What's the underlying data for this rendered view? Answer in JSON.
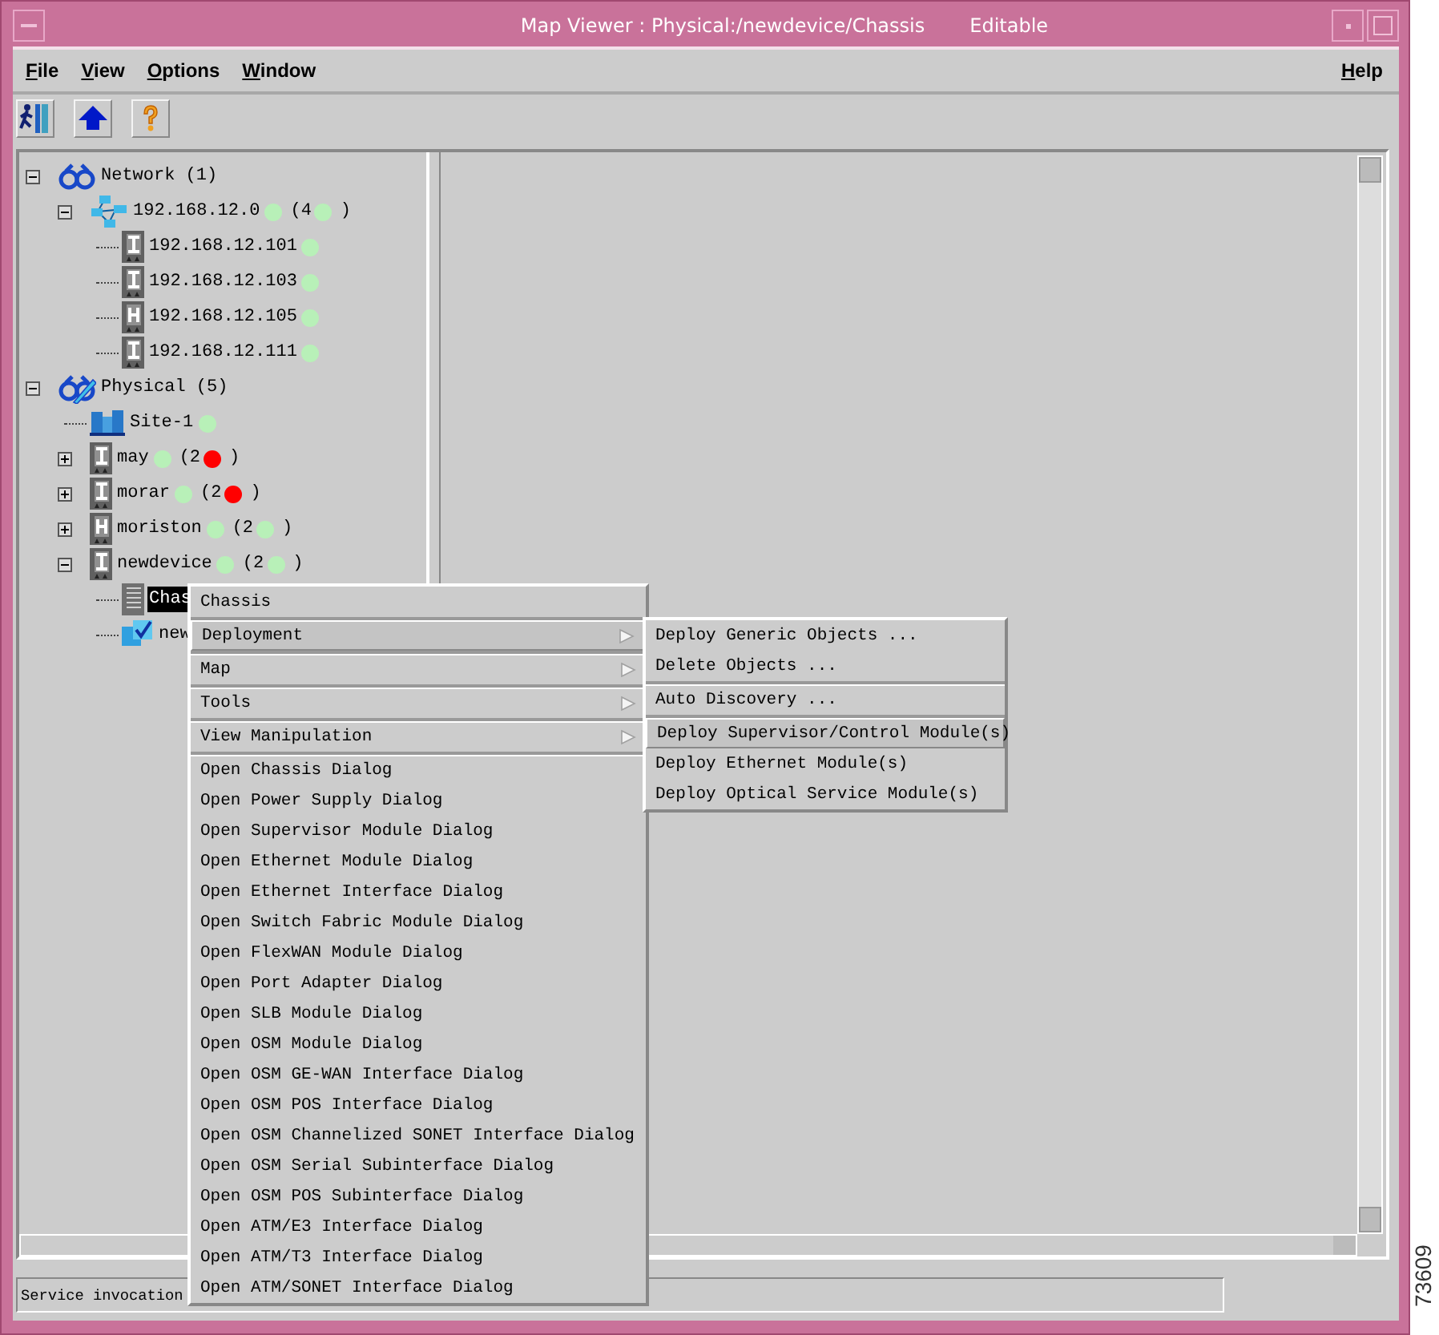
{
  "window": {
    "title": "Map Viewer : Physical:/newdevice/Chassis",
    "mode": "Editable"
  },
  "menubar": {
    "left": [
      "File",
      "View",
      "Options",
      "Window"
    ],
    "right": "Help"
  },
  "toolbar": [
    {
      "kind": "exit"
    },
    {
      "kind": "up"
    },
    {
      "kind": "help"
    }
  ],
  "tree": [
    {
      "label": "Network (1)",
      "kind": "network",
      "expanded": true,
      "selected": false,
      "children": [
        {
          "label": "192.168.12.0",
          "kind": "subnet",
          "expanded": true,
          "selected": false,
          "color": "#b8f0b8",
          "count": {
            "text": "(4",
            "color": "#b8f0b8",
            "close": ")"
          },
          "children": [
            {
              "label": "192.168.12.101",
              "kind": "device",
              "selected": false,
              "color": "#b8f0b8"
            },
            {
              "label": "192.168.12.103",
              "kind": "device",
              "selected": false,
              "color": "#b8f0b8"
            },
            {
              "label": "192.168.12.105",
              "kind": "router",
              "selected": false,
              "color": "#b8f0b8"
            },
            {
              "label": "192.168.12.111",
              "kind": "device",
              "selected": false,
              "color": "#b8f0b8"
            }
          ]
        }
      ]
    },
    {
      "label": "Physical (5)",
      "kind": "physical",
      "expanded": true,
      "selected": false,
      "children": [
        {
          "label": "Site-1",
          "kind": "site",
          "selected": false,
          "color": "#b8f0b8"
        },
        {
          "label": "may",
          "kind": "device",
          "expanded": false,
          "selected": false,
          "color": "#b8f0b8",
          "count": {
            "text": "(2",
            "color": "#ff0000",
            "close": ")"
          }
        },
        {
          "label": "morar",
          "kind": "device",
          "expanded": false,
          "selected": false,
          "color": "#b8f0b8",
          "count": {
            "text": "(2",
            "color": "#ff0000",
            "close": ")"
          }
        },
        {
          "label": "moriston",
          "kind": "router",
          "expanded": false,
          "selected": false,
          "color": "#b8f0b8",
          "count": {
            "text": "(2",
            "color": "#b8f0b8",
            "close": ")"
          }
        },
        {
          "label": "newdevice",
          "kind": "device",
          "expanded": true,
          "selected": false,
          "color": "#b8f0b8",
          "count": {
            "text": "(2",
            "color": "#b8f0b8",
            "close": ")"
          },
          "children": [
            {
              "label": "Chas",
              "kind": "chassis",
              "selected": true
            },
            {
              "label": "new",
              "kind": "view",
              "selected": false
            }
          ]
        }
      ]
    }
  ],
  "context_menu": {
    "groups": [
      [
        {
          "label": "Chassis",
          "submenu": false,
          "selected": false
        }
      ],
      [
        {
          "label": "Deployment",
          "submenu": true,
          "selected": true
        }
      ],
      [
        {
          "label": "Map",
          "submenu": true,
          "selected": false
        }
      ],
      [
        {
          "label": "Tools",
          "submenu": true,
          "selected": false
        }
      ],
      [
        {
          "label": "View Manipulation",
          "submenu": true,
          "selected": false
        }
      ],
      [
        {
          "label": "Open Chassis Dialog",
          "submenu": false,
          "selected": false
        },
        {
          "label": "Open Power Supply Dialog",
          "submenu": false,
          "selected": false
        },
        {
          "label": "Open Supervisor Module Dialog",
          "submenu": false,
          "selected": false
        },
        {
          "label": "Open Ethernet Module Dialog",
          "submenu": false,
          "selected": false
        },
        {
          "label": "Open Ethernet Interface Dialog",
          "submenu": false,
          "selected": false
        },
        {
          "label": "Open Switch Fabric Module Dialog",
          "submenu": false,
          "selected": false
        },
        {
          "label": "Open FlexWAN Module Dialog",
          "submenu": false,
          "selected": false
        },
        {
          "label": "Open Port Adapter Dialog",
          "submenu": false,
          "selected": false
        },
        {
          "label": "Open SLB Module Dialog",
          "submenu": false,
          "selected": false
        },
        {
          "label": "Open OSM Module Dialog",
          "submenu": false,
          "selected": false
        },
        {
          "label": "Open OSM GE-WAN Interface Dialog",
          "submenu": false,
          "selected": false
        },
        {
          "label": "Open OSM POS Interface Dialog",
          "submenu": false,
          "selected": false
        },
        {
          "label": "Open OSM Channelized SONET Interface Dialog",
          "submenu": false,
          "selected": false
        },
        {
          "label": "Open OSM Serial Subinterface Dialog",
          "submenu": false,
          "selected": false
        },
        {
          "label": "Open OSM POS Subinterface Dialog",
          "submenu": false,
          "selected": false
        },
        {
          "label": "Open ATM/E3 Interface Dialog",
          "submenu": false,
          "selected": false
        },
        {
          "label": "Open ATM/T3 Interface Dialog",
          "submenu": false,
          "selected": false
        },
        {
          "label": "Open ATM/SONET Interface Dialog",
          "submenu": false,
          "selected": false
        }
      ]
    ]
  },
  "submenu": {
    "groups": [
      [
        {
          "label": "Deploy Generic Objects ...",
          "selected": false
        },
        {
          "label": "Delete Objects ...",
          "selected": false
        }
      ],
      [
        {
          "label": "Auto Discovery ...",
          "selected": false
        }
      ],
      [
        {
          "label": "Deploy Supervisor/Control Module(s)",
          "selected": true
        },
        {
          "label": "Deploy Ethernet Module(s)",
          "selected": false
        },
        {
          "label": "Deploy Optical Service Module(s)",
          "selected": false
        }
      ]
    ]
  },
  "status_bar": "Service invocation",
  "figure_number": "73609"
}
